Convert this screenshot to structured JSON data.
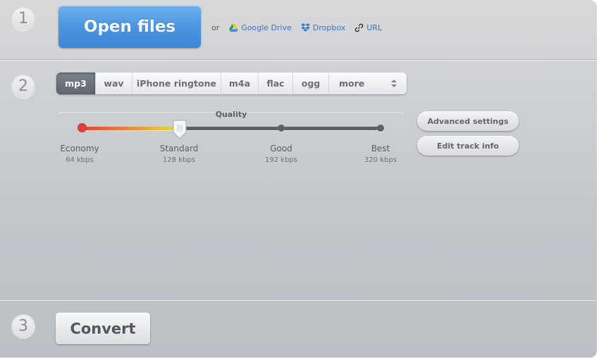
{
  "steps": [
    "1",
    "2",
    "3"
  ],
  "step1": {
    "open_button": "Open files",
    "or_label": "or",
    "sources": [
      {
        "label": "Google Drive",
        "icon": "google-drive-icon"
      },
      {
        "label": "Dropbox",
        "icon": "dropbox-icon"
      },
      {
        "label": "URL",
        "icon": "link-icon"
      }
    ]
  },
  "step2": {
    "formats": [
      {
        "label": "mp3",
        "active": true
      },
      {
        "label": "wav",
        "active": false
      },
      {
        "label": "iPhone ringtone",
        "active": false
      },
      {
        "label": "m4a",
        "active": false
      },
      {
        "label": "flac",
        "active": false
      },
      {
        "label": "ogg",
        "active": false
      }
    ],
    "more_label": "more",
    "quality": {
      "title": "Quality",
      "selected_index": 1,
      "levels": [
        {
          "name": "Economy",
          "rate": "64 kbps"
        },
        {
          "name": "Standard",
          "rate": "128 kbps"
        },
        {
          "name": "Good",
          "rate": "192 kbps"
        },
        {
          "name": "Best",
          "rate": "320 kbps"
        }
      ]
    },
    "advanced_settings": "Advanced settings",
    "edit_track_info": "Edit track info"
  },
  "step3": {
    "convert_button": "Convert"
  },
  "colors": {
    "primary_blue": "#4b95e0",
    "link_blue": "#3d72c6",
    "active_tab": "#6b727c"
  }
}
